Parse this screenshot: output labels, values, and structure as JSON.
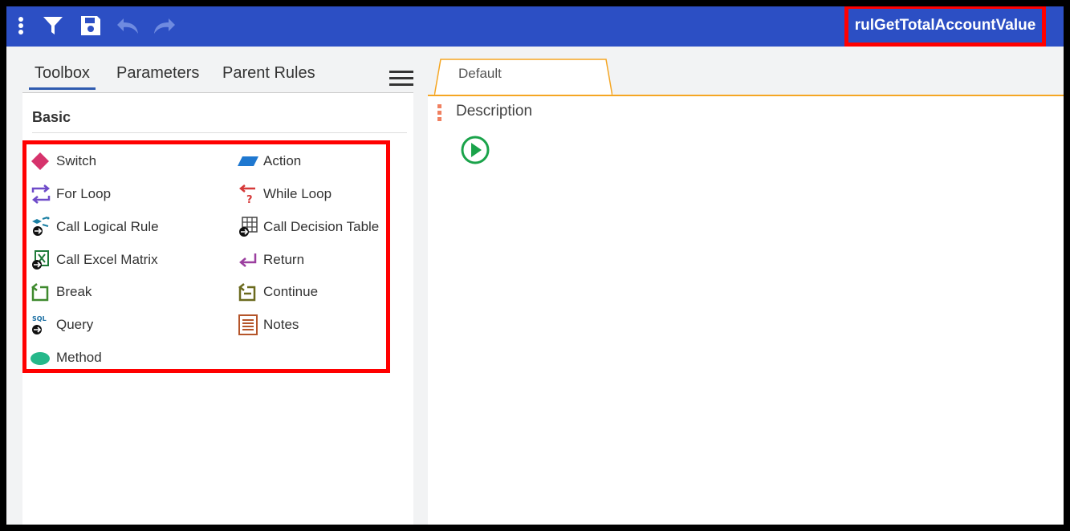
{
  "toolbar": {
    "icons": [
      "more-vertical-icon",
      "filter-icon",
      "save-icon",
      "undo-icon",
      "redo-icon"
    ],
    "rule_name": "rulGetTotalAccountValue",
    "bar_color": "#2c4fc4"
  },
  "left_panel": {
    "tabs": [
      {
        "label": "Toolbox",
        "active": true
      },
      {
        "label": "Parameters",
        "active": false
      },
      {
        "label": "Parent Rules",
        "active": false
      }
    ],
    "section_title": "Basic",
    "tools": [
      {
        "label": "Switch",
        "icon": "switch-diamond-icon"
      },
      {
        "label": "Action",
        "icon": "action-parallelogram-icon"
      },
      {
        "label": "For Loop",
        "icon": "for-loop-icon"
      },
      {
        "label": "While Loop",
        "icon": "while-loop-icon"
      },
      {
        "label": "Call Logical Rule",
        "icon": "call-logical-rule-icon"
      },
      {
        "label": "Call Decision Table",
        "icon": "call-decision-table-icon"
      },
      {
        "label": "Call Excel Matrix",
        "icon": "call-excel-matrix-icon"
      },
      {
        "label": "Return",
        "icon": "return-icon"
      },
      {
        "label": "Break",
        "icon": "break-icon"
      },
      {
        "label": "Continue",
        "icon": "continue-icon"
      },
      {
        "label": "Query",
        "icon": "query-sql-icon"
      },
      {
        "label": "Notes",
        "icon": "notes-icon"
      },
      {
        "label": "Method",
        "icon": "method-ellipse-icon"
      }
    ]
  },
  "right_panel": {
    "tab_label": "Default",
    "description_label": "Description",
    "start_icon": "play-circle-icon"
  },
  "colors": {
    "highlight": "#ff0000",
    "accent_orange": "#f5a623",
    "start_green": "#1aa34a"
  }
}
